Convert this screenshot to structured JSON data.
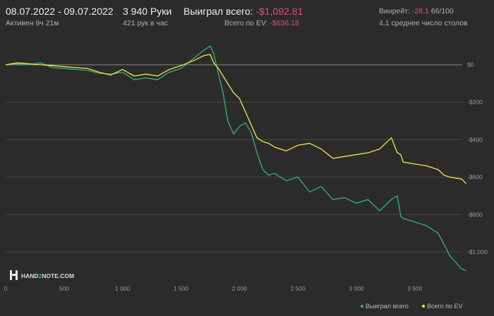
{
  "header": {
    "date_range": "08.07.2022 - 09.07.2022",
    "active": "Активен 9ч 21м",
    "hands": "3 940 Руки",
    "hands_per_hour": "421 рук в час",
    "won_label": "Выиграл всего:",
    "won_value": "-$1,092.81",
    "ev_label": "Всего по EV:",
    "ev_value": "-$636.18",
    "winrate_label": "Винрейт:",
    "winrate_value": "-28.1",
    "winrate_hands": "66/100",
    "avg_tables": "4.1 среднее число столов"
  },
  "logo": {
    "left": "HAND",
    "mid": "2",
    "right": "NOTE.COM"
  },
  "colors": {
    "won": "#2fb57a",
    "ev": "#f2e64a",
    "negative": "#e0506e",
    "grid": "#474747",
    "zero_line": "#8a8a8a",
    "background": "#2b2b2b"
  },
  "chart_data": {
    "type": "line",
    "x_ticks": [
      "0",
      "500",
      "1 000",
      "1 500",
      "2 000",
      "2 500",
      "3 000",
      "3 500"
    ],
    "y_ticks": [
      "$0",
      "-$200",
      "-$400",
      "-$600",
      "-$800",
      "-$1,000"
    ],
    "xlim": [
      0,
      3940
    ],
    "ylim": [
      -1130,
      120
    ],
    "legend_position": "bottom-right",
    "series": [
      {
        "name": "Выиграл всего",
        "color": "#2fb57a",
        "x": [
          0,
          100,
          200,
          300,
          400,
          500,
          600,
          700,
          800,
          900,
          1000,
          1100,
          1200,
          1300,
          1400,
          1500,
          1600,
          1700,
          1750,
          1780,
          1820,
          1860,
          1900,
          1950,
          2000,
          2050,
          2100,
          2150,
          2200,
          2250,
          2300,
          2400,
          2500,
          2600,
          2700,
          2800,
          2900,
          3000,
          3100,
          3200,
          3300,
          3350,
          3380,
          3400,
          3500,
          3600,
          3700,
          3750,
          3800,
          3900,
          3940
        ],
        "values": [
          0,
          5,
          0,
          10,
          -15,
          -20,
          -25,
          -30,
          -45,
          -50,
          -40,
          -80,
          -70,
          -80,
          -40,
          -20,
          30,
          80,
          100,
          60,
          -50,
          -150,
          -300,
          -370,
          -330,
          -310,
          -360,
          -470,
          -560,
          -590,
          -580,
          -620,
          -600,
          -680,
          -650,
          -720,
          -710,
          -740,
          -720,
          -780,
          -720,
          -700,
          -810,
          -820,
          -840,
          -860,
          -900,
          -960,
          -1020,
          -1090,
          -1100
        ]
      },
      {
        "name": "Всего по EV",
        "color": "#f2e64a",
        "x": [
          0,
          100,
          200,
          300,
          400,
          500,
          600,
          700,
          800,
          900,
          1000,
          1100,
          1200,
          1300,
          1400,
          1500,
          1600,
          1700,
          1750,
          1780,
          1820,
          1860,
          1900,
          1950,
          2000,
          2050,
          2100,
          2150,
          2200,
          2250,
          2300,
          2400,
          2500,
          2600,
          2700,
          2800,
          2900,
          3000,
          3100,
          3200,
          3300,
          3350,
          3380,
          3400,
          3500,
          3600,
          3700,
          3750,
          3800,
          3900,
          3940
        ],
        "values": [
          0,
          10,
          5,
          0,
          -5,
          -10,
          -15,
          -20,
          -40,
          -55,
          -25,
          -60,
          -50,
          -60,
          -25,
          -5,
          20,
          50,
          55,
          10,
          -20,
          -60,
          -100,
          -150,
          -180,
          -250,
          -320,
          -390,
          -410,
          -420,
          -440,
          -460,
          -430,
          -420,
          -450,
          -500,
          -490,
          -480,
          -470,
          -450,
          -390,
          -470,
          -480,
          -520,
          -530,
          -540,
          -560,
          -590,
          -600,
          -610,
          -635
        ]
      }
    ]
  }
}
